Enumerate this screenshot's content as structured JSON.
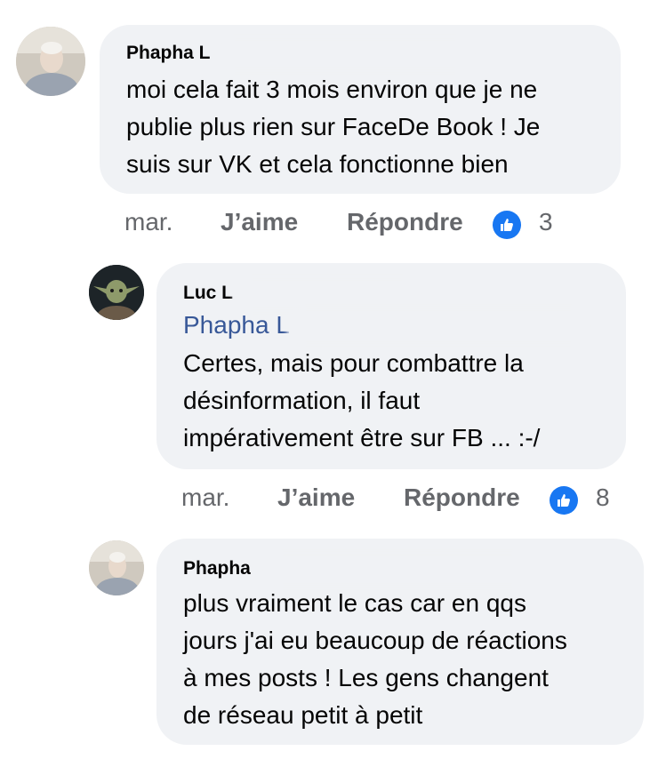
{
  "comments": [
    {
      "author": "Phapha L",
      "lines": [
        "moi cela fait 3 mois environ que je ne",
        "publie plus rien sur FaceDe Book  ! Je",
        "suis sur VK et cela fonctionne bien"
      ],
      "time": "mar.",
      "like_label": "J’aime",
      "reply_label": "Répondre",
      "reactions": "3"
    },
    {
      "author": "Luc L",
      "mention": "Phapha L",
      "lines": [
        "Certes, mais pour combattre la",
        "désinformation, il faut",
        "impérativement être sur FB ... :-/"
      ],
      "time": "mar.",
      "like_label": "J’aime",
      "reply_label": "Répondre",
      "reactions": "8"
    },
    {
      "author": "Phapha",
      "lines": [
        "plus vraiment le cas car en qqs",
        "jours j'ai eu beaucoup de réactions",
        "à mes posts ! Les gens changent",
        "de réseau petit à petit"
      ]
    }
  ],
  "colors": {
    "bubble": "#f0f2f5",
    "mention": "#385898",
    "meta": "#65676b",
    "like_badge": "#1877f2"
  }
}
